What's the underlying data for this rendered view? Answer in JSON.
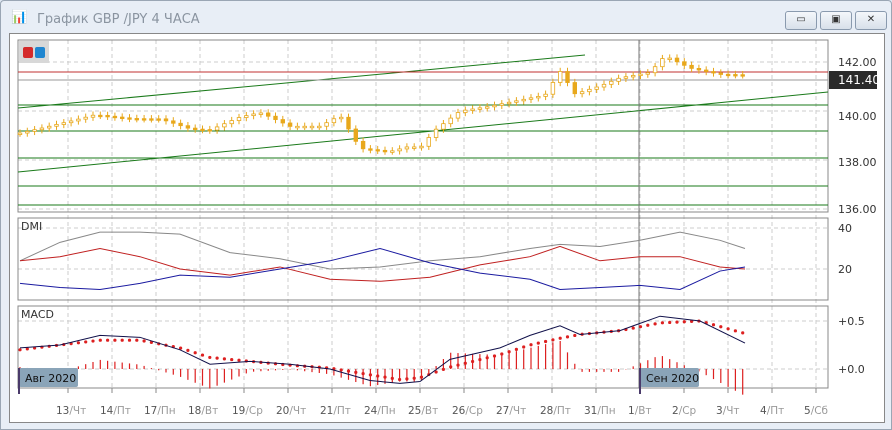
{
  "window": {
    "title": "График GBP /JPY  4 ЧАСА",
    "minimize": "▭",
    "restore": "▣",
    "close": "✕"
  },
  "price_scale": {
    "labels": [
      "142.00",
      "140.00",
      "138.00",
      "136.00"
    ],
    "current": "141.40"
  },
  "dmi": {
    "label": "DMI",
    "scale": [
      "40",
      "20"
    ]
  },
  "macd": {
    "label": "MACD",
    "scale": [
      "+0.5",
      "+0.0"
    ]
  },
  "markers": {
    "month1": "Авг 2020",
    "month2": "Сен 2020"
  },
  "x_axis": [
    [
      "13",
      "/Чт"
    ],
    [
      "14",
      "/Пт"
    ],
    [
      "17",
      "/Пн"
    ],
    [
      "18",
      "/Вт"
    ],
    [
      "19",
      "/Ср"
    ],
    [
      "20",
      "/Чт"
    ],
    [
      "21",
      "/Пт"
    ],
    [
      "24",
      "/Пн"
    ],
    [
      "25",
      "/Вт"
    ],
    [
      "26",
      "/Ср"
    ],
    [
      "27",
      "/Чт"
    ],
    [
      "28",
      "/Пт"
    ],
    [
      "31",
      "/Пн"
    ],
    [
      "1",
      "/Вт"
    ],
    [
      "2",
      "/Ср"
    ],
    [
      "3",
      "/Чт"
    ],
    [
      "4",
      "/Пт"
    ],
    [
      "5",
      "/Сб"
    ]
  ],
  "colors": {
    "candle": "#e8a81c",
    "trend": "#1a7a1a",
    "red_line": "#c03030",
    "adx": "#888888",
    "plus_di": "#c02020",
    "minus_di": "#1a1aa0",
    "macd": "#10104a",
    "signal": "#dd2020"
  },
  "chart_data": {
    "type": "line",
    "price": {
      "t": [
        0,
        40,
        75,
        110,
        140,
        170,
        190,
        220,
        240,
        270,
        300,
        320,
        325,
        340,
        370,
        390,
        400,
        415,
        440,
        470,
        500,
        525,
        540,
        555,
        580,
        600,
        630,
        645,
        670,
        700,
        725
      ],
      "close": [
        139.1,
        139.6,
        140.0,
        139.8,
        139.7,
        139.2,
        139.1,
        139.6,
        139.8,
        139.3,
        139.4,
        139.9,
        139.6,
        138.6,
        138.5,
        138.7,
        138.6,
        139.3,
        140.0,
        140.1,
        140.3,
        140.5,
        141.5,
        140.6,
        141.0,
        141.4,
        141.7,
        142.4,
        141.9,
        141.6,
        141.5
      ]
    },
    "dmi": {
      "t": [
        0,
        40,
        80,
        120,
        160,
        210,
        260,
        310,
        360,
        410,
        460,
        510,
        540,
        580,
        620,
        660,
        700,
        725
      ],
      "adx": [
        24,
        33,
        38,
        38,
        37,
        28,
        25,
        20,
        21,
        24,
        26,
        30,
        32,
        31,
        34,
        38,
        34,
        30
      ],
      "plus_di": [
        24,
        26,
        30,
        26,
        20,
        17,
        21,
        15,
        14,
        16,
        22,
        26,
        31,
        24,
        26,
        26,
        21,
        20
      ],
      "minus_di": [
        13,
        11,
        10,
        13,
        17,
        16,
        20,
        24,
        30,
        23,
        18,
        15,
        10,
        11,
        12,
        10,
        19,
        21
      ]
    },
    "macd": {
      "t": [
        0,
        40,
        80,
        120,
        160,
        190,
        230,
        270,
        310,
        350,
        380,
        400,
        430,
        480,
        510,
        540,
        560,
        600,
        640,
        680,
        725
      ],
      "macd": [
        0.22,
        0.25,
        0.35,
        0.33,
        0.2,
        0.05,
        0.08,
        0.05,
        0.0,
        -0.12,
        -0.15,
        -0.13,
        0.1,
        0.22,
        0.35,
        0.45,
        0.36,
        0.4,
        0.55,
        0.5,
        0.27
      ],
      "signal": [
        0.2,
        0.25,
        0.3,
        0.3,
        0.22,
        0.12,
        0.08,
        0.04,
        0.01,
        -0.06,
        -0.11,
        -0.09,
        0.02,
        0.15,
        0.25,
        0.32,
        0.36,
        0.4,
        0.48,
        0.5,
        0.37
      ]
    }
  }
}
